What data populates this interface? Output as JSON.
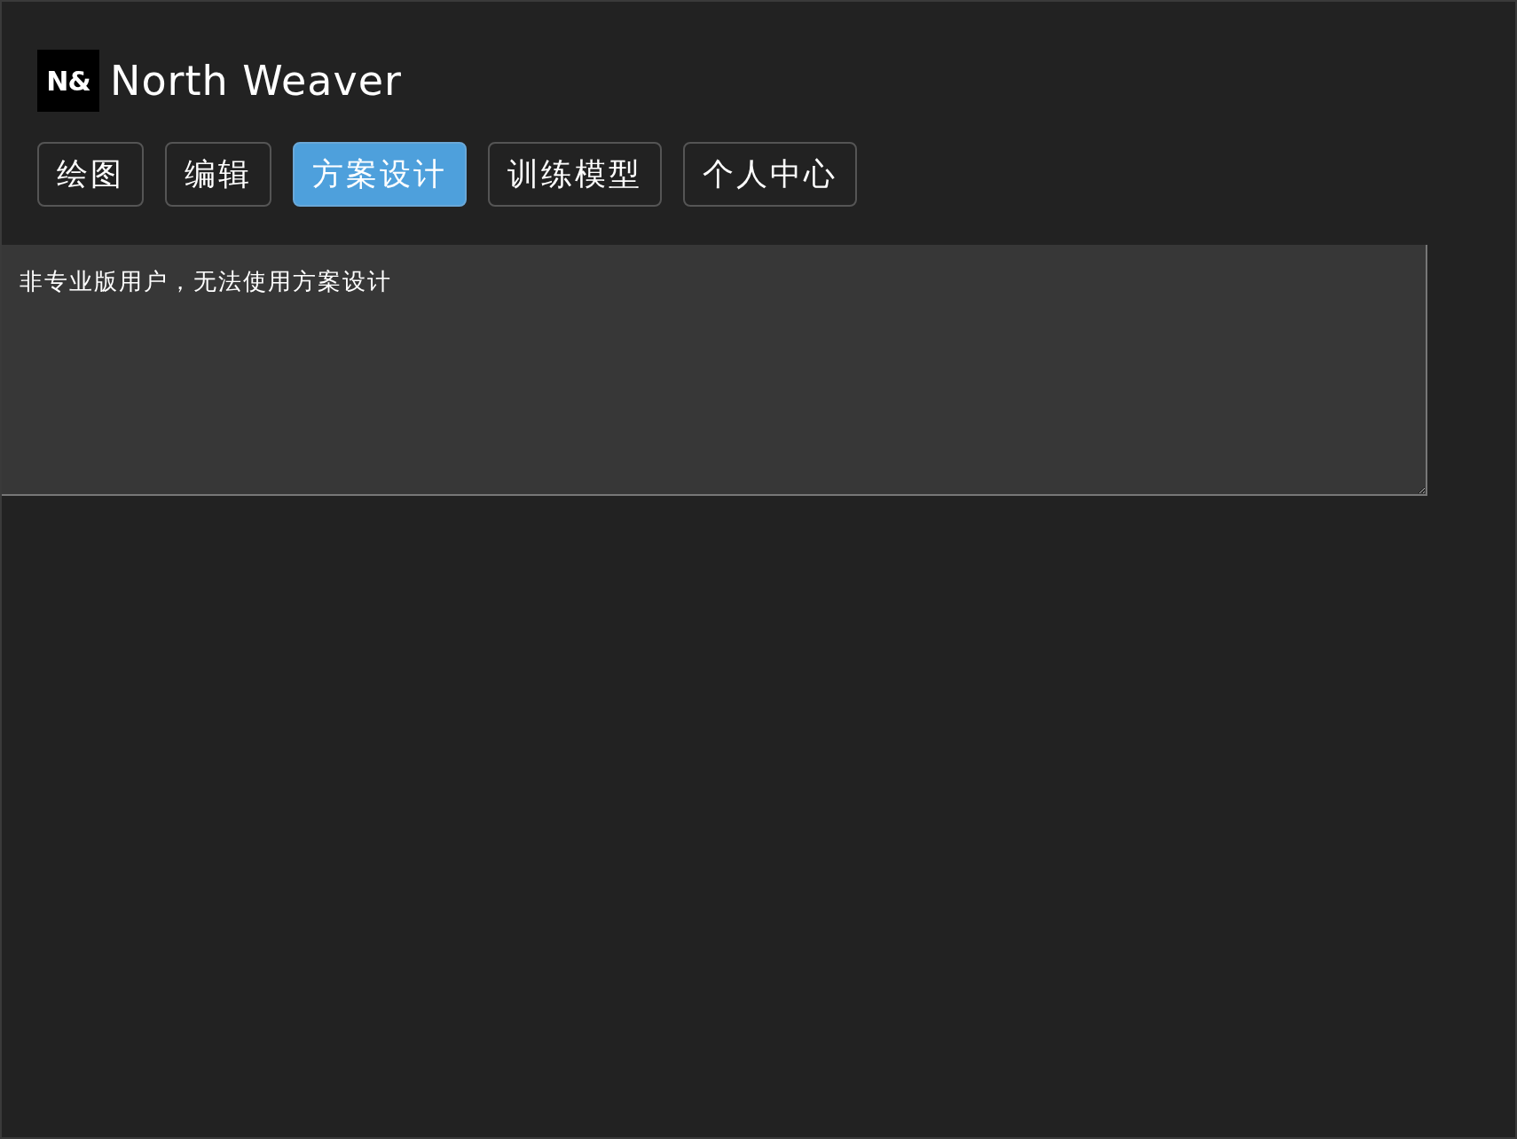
{
  "logo": {
    "mark": "N&",
    "name": "North Weaver"
  },
  "tabs": [
    {
      "label": "绘图",
      "selected": false
    },
    {
      "label": "编辑",
      "selected": false
    },
    {
      "label": "方案设计",
      "selected": true
    },
    {
      "label": "训练模型",
      "selected": false
    },
    {
      "label": "个人中心",
      "selected": false
    }
  ],
  "output": {
    "value": "非专业版用户，无法使用方案设计"
  }
}
